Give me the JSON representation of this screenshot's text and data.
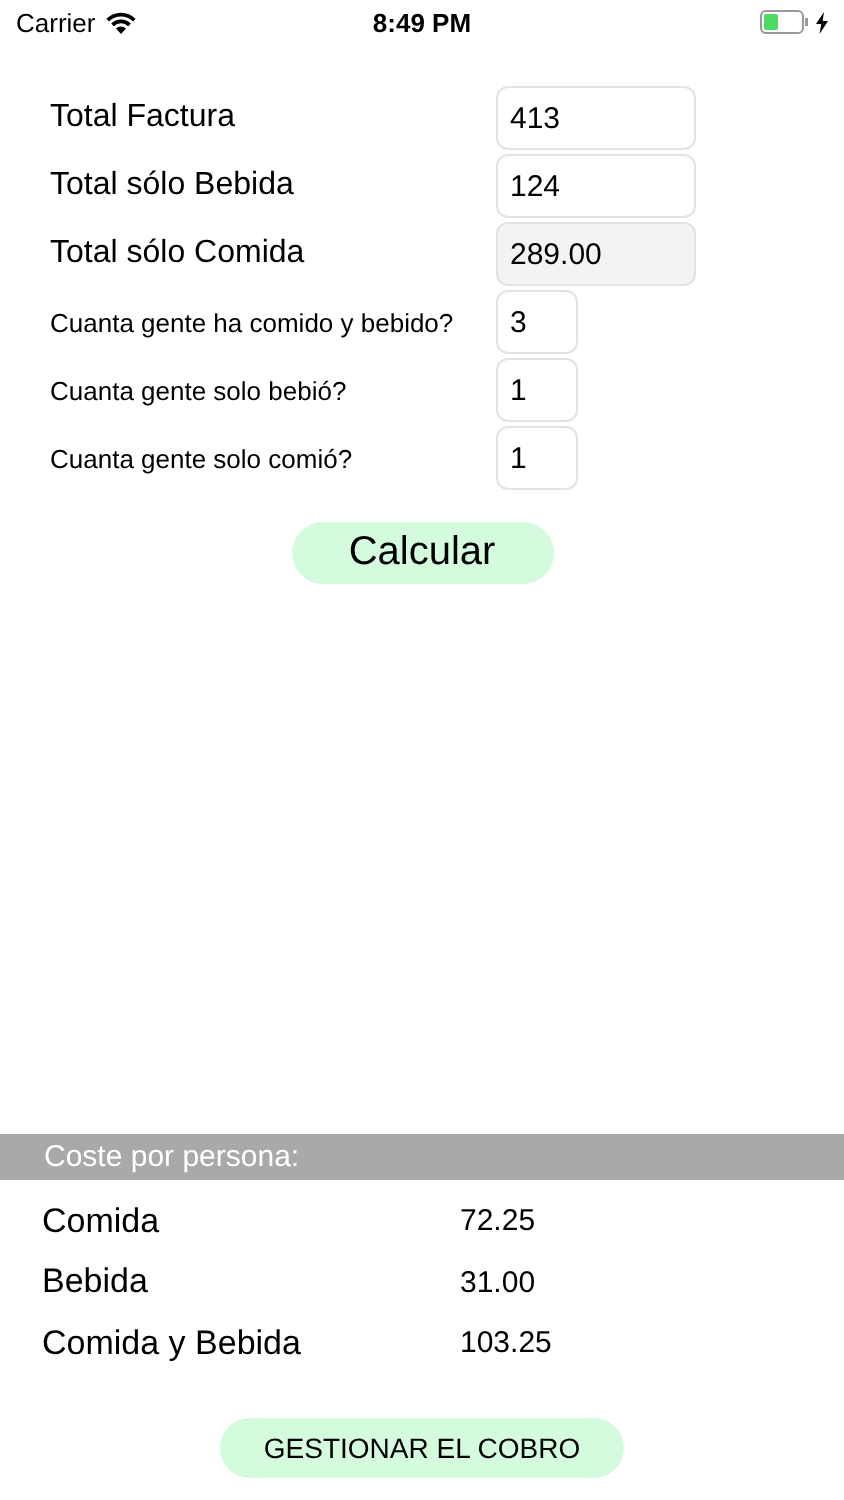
{
  "status_bar": {
    "carrier": "Carrier",
    "time": "8:49 PM"
  },
  "fields": [
    {
      "label": "Total Factura",
      "value": "413",
      "kind": "wide",
      "disabled": false
    },
    {
      "label": "Total sólo Bebida",
      "value": "124",
      "kind": "wide",
      "disabled": false
    },
    {
      "label": "Total sólo Comida",
      "value": "289.00",
      "kind": "wide",
      "disabled": true
    },
    {
      "label": "Cuanta gente ha comido y bebido?",
      "value": "3",
      "kind": "narrow",
      "disabled": false
    },
    {
      "label": "Cuanta gente solo bebió?",
      "value": "1",
      "kind": "narrow",
      "disabled": false
    },
    {
      "label": "Cuanta gente solo comió?",
      "value": "1",
      "kind": "narrow",
      "disabled": false
    }
  ],
  "calculate_button": "Calcular",
  "results": {
    "header": "Coste por persona:",
    "rows": [
      {
        "label": "Comida",
        "value": "72.25"
      },
      {
        "label": "Bebida",
        "value": "31.00"
      },
      {
        "label": "Comida y Bebida",
        "value": "103.25"
      }
    ]
  },
  "manage_button": "GESTIONAR EL COBRO"
}
